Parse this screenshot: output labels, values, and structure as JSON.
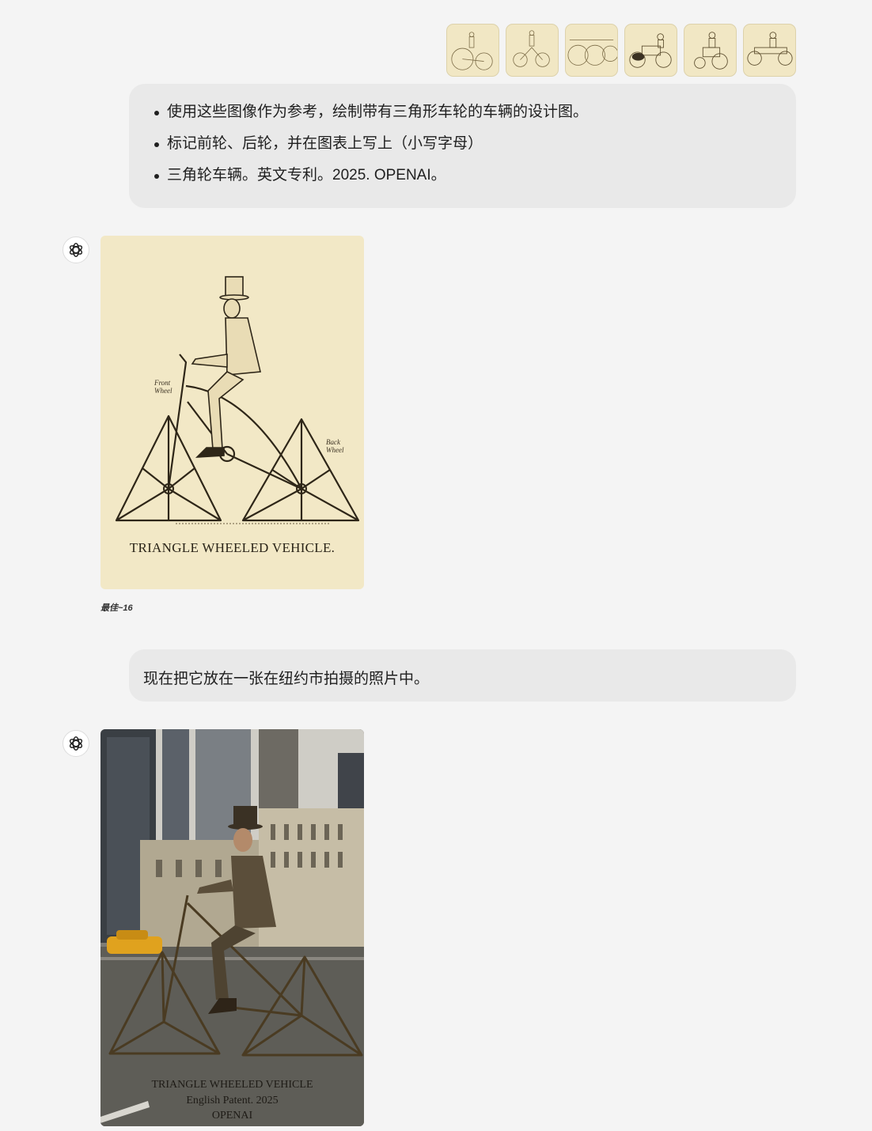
{
  "conversation": {
    "reference_images": [
      {
        "alt": "reference-engraving-1"
      },
      {
        "alt": "reference-engraving-2"
      },
      {
        "alt": "reference-engraving-3"
      },
      {
        "alt": "reference-engraving-4"
      },
      {
        "alt": "reference-engraving-5"
      },
      {
        "alt": "reference-engraving-6"
      }
    ],
    "user_message_1": {
      "items": [
        "使用这些图像作为参考，绘制带有三角形车轮的车辆的设计图。",
        "标记前轮、后轮，并在图表上写上（小写字母）",
        "三角轮车辆。英文专利。2025. OPENAI。"
      ]
    },
    "assistant_image_1": {
      "front_label": "Front Wheel",
      "back_label": "Back Wheel",
      "caption": "TRIANGLE WHEELED VEHICLE.",
      "meta": "最佳~16"
    },
    "user_message_2": {
      "text": "现在把它放在一张在纽约市拍摄的照片中。"
    },
    "assistant_image_2": {
      "caption_line1": "TRIANGLE WHEELED VEHICLE",
      "caption_line2": "English Patent. 2025",
      "caption_line3": "OPENAI"
    }
  },
  "colors": {
    "page_bg": "#f4f4f4",
    "bubble_bg": "#e9e9e9",
    "parchment": "#f2e8c6"
  }
}
